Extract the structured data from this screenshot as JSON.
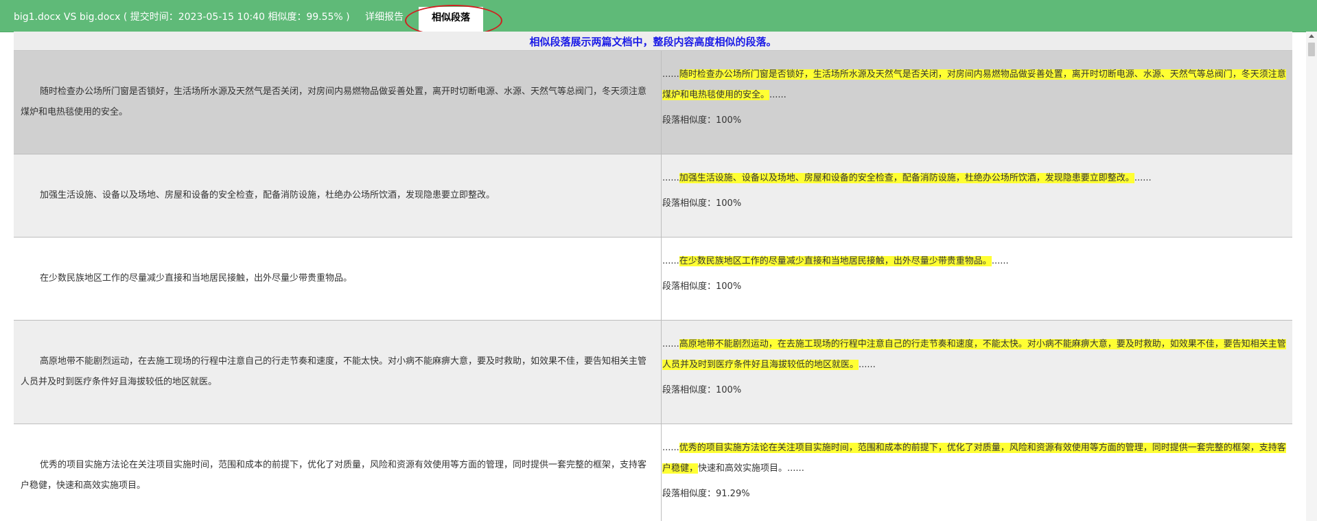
{
  "header": {
    "title": "big1.docx VS big.docx ( 提交时间：2023-05-15 10:40 相似度：99.55% )",
    "tabs": [
      {
        "label": "详细报告"
      },
      {
        "label": "相似段落"
      }
    ]
  },
  "intro": "相似段落展示两篇文档中，整段内容高度相似的段落。",
  "rows": [
    {
      "left": "随时检查办公场所门窗是否锁好，生活场所水源及天然气是否关闭，对房间内易燃物品做妥善处置，离开时切断电源、水源、天然气等总阀门，冬天须注意煤炉和电热毯使用的安全。",
      "prefix": "......",
      "highlight": "随时检查办公场所门窗是否锁好，生活场所水源及天然气是否关闭，对房间内易燃物品做妥善处置，离开时切断电源、水源、天然气等总阀门，冬天须注意煤炉和电热毯使用的安全。",
      "rest": "",
      "suffix": "......",
      "similarity": "段落相似度：100%"
    },
    {
      "left": "加强生活设施、设备以及场地、房屋和设备的安全检查，配备消防设施，杜绝办公场所饮酒，发现隐患要立即整改。",
      "prefix": "......",
      "highlight": "加强生活设施、设备以及场地、房屋和设备的安全检查，配备消防设施，杜绝办公场所饮酒，发现隐患要立即整改。",
      "rest": "",
      "suffix": "......",
      "similarity": "段落相似度：100%"
    },
    {
      "left": "在少数民族地区工作的尽量减少直接和当地居民接触，出外尽量少带贵重物品。",
      "prefix": "......",
      "highlight": "在少数民族地区工作的尽量减少直接和当地居民接触，出外尽量少带贵重物品。",
      "rest": "",
      "suffix": "......",
      "similarity": "段落相似度：100%"
    },
    {
      "left": "高原地带不能剧烈运动，在去施工现场的行程中注意自己的行走节奏和速度，不能太快。对小病不能麻痹大意，要及时救助，如效果不佳，要告知相关主管人员并及时到医疗条件好且海拔较低的地区就医。",
      "prefix": "......",
      "highlight": "高原地带不能剧烈运动，在去施工现场的行程中注意自己的行走节奏和速度，不能太快。对小病不能麻痹大意，要及时救助，如效果不佳，要告知相关主管人员并及时到医疗条件好且海拔较低的地区就医。",
      "rest": "",
      "suffix": "......",
      "similarity": "段落相似度：100%"
    },
    {
      "left": "优秀的项目实施方法论在关注项目实施时间，范围和成本的前提下，优化了对质量，风险和资源有效使用等方面的管理，同时提供一套完整的框架，支持客户稳健，快速和高效实施项目。",
      "prefix": "......",
      "highlight": "优秀的项目实施方法论在关注项目实施时间，范围和成本的前提下，优化了对质量，风险和资源有效使用等方面的管理，同时提供一套完整的框架，支持客户稳健，",
      "rest": "快速和高效实施项目。",
      "suffix": "......",
      "similarity": "段落相似度：91.29%"
    }
  ]
}
